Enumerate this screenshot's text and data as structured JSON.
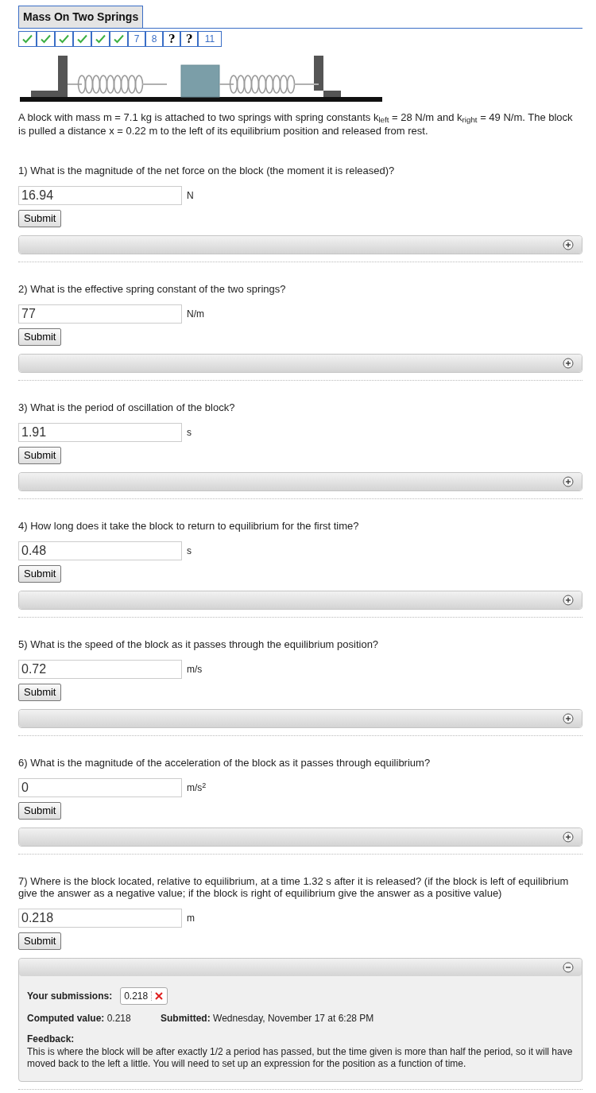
{
  "title": "Mass On Two Springs",
  "nav": [
    {
      "kind": "check"
    },
    {
      "kind": "check"
    },
    {
      "kind": "check"
    },
    {
      "kind": "check"
    },
    {
      "kind": "check"
    },
    {
      "kind": "check"
    },
    {
      "kind": "number",
      "label": "7"
    },
    {
      "kind": "number",
      "label": "8"
    },
    {
      "kind": "help",
      "label": "?"
    },
    {
      "kind": "help",
      "label": "?"
    },
    {
      "kind": "number",
      "label": "11"
    }
  ],
  "intro": "A block with mass m = 7.1 kg is attached to two springs with spring constants k$_{left}$ = 28 N/m and k$_{right}$ = 49 N/m. The block is pulled a distance x = 0.22 m to the left of its equilibrium position and released from rest.",
  "questions": [
    {
      "question": "1) What is the magnitude of the net force on the block (the moment it is released)?",
      "value": "16.94",
      "unit": "N",
      "button": "Submit",
      "expanded": false
    },
    {
      "question": "2) What is the effective spring constant of the two springs?",
      "value": "77",
      "unit": "N/m",
      "button": "Submit",
      "expanded": false
    },
    {
      "question": "3) What is the period of oscillation of the block?",
      "value": "1.91",
      "unit": "s",
      "button": "Submit",
      "expanded": false
    },
    {
      "question": "4) How long does it take the block to return to equilibrium for the first time?",
      "value": "0.48",
      "unit": "s",
      "button": "Submit",
      "expanded": false
    },
    {
      "question": "5) What is the speed of the block as it passes through the equilibrium position?",
      "value": "0.72",
      "unit": "m/s",
      "button": "Submit",
      "expanded": false
    },
    {
      "question": "6) What is the magnitude of the acceleration of the block as it passes through equilibrium?",
      "value": "0",
      "unit": "m/s$^{2}$",
      "button": "Submit",
      "expanded": false
    },
    {
      "question": "7) Where is the block located, relative to equilibrium, at a time 1.32 s after it is released? (if the block is left of equilibrium give the answer as a negative value; if the block is right of equilibrium give the answer as a positive value)",
      "value": "0.218",
      "unit": "m",
      "button": "Submit",
      "expanded": true,
      "details": {
        "submissions_label": "Your submissions:",
        "submissions": [
          {
            "value": "0.218",
            "correct": false
          }
        ],
        "computed_label": "Computed value:",
        "computed": "0.218",
        "submitted_label": "Submitted:",
        "submitted": "Wednesday, November 17 at 6:28 PM",
        "feedback_label": "Feedback:",
        "feedback": "This is where the block will be after exactly 1/2 a period has passed, but the time given is more than half the period, so it will have moved back to the left a little. You will need to set up an expression for the position as a function of time."
      }
    }
  ]
}
